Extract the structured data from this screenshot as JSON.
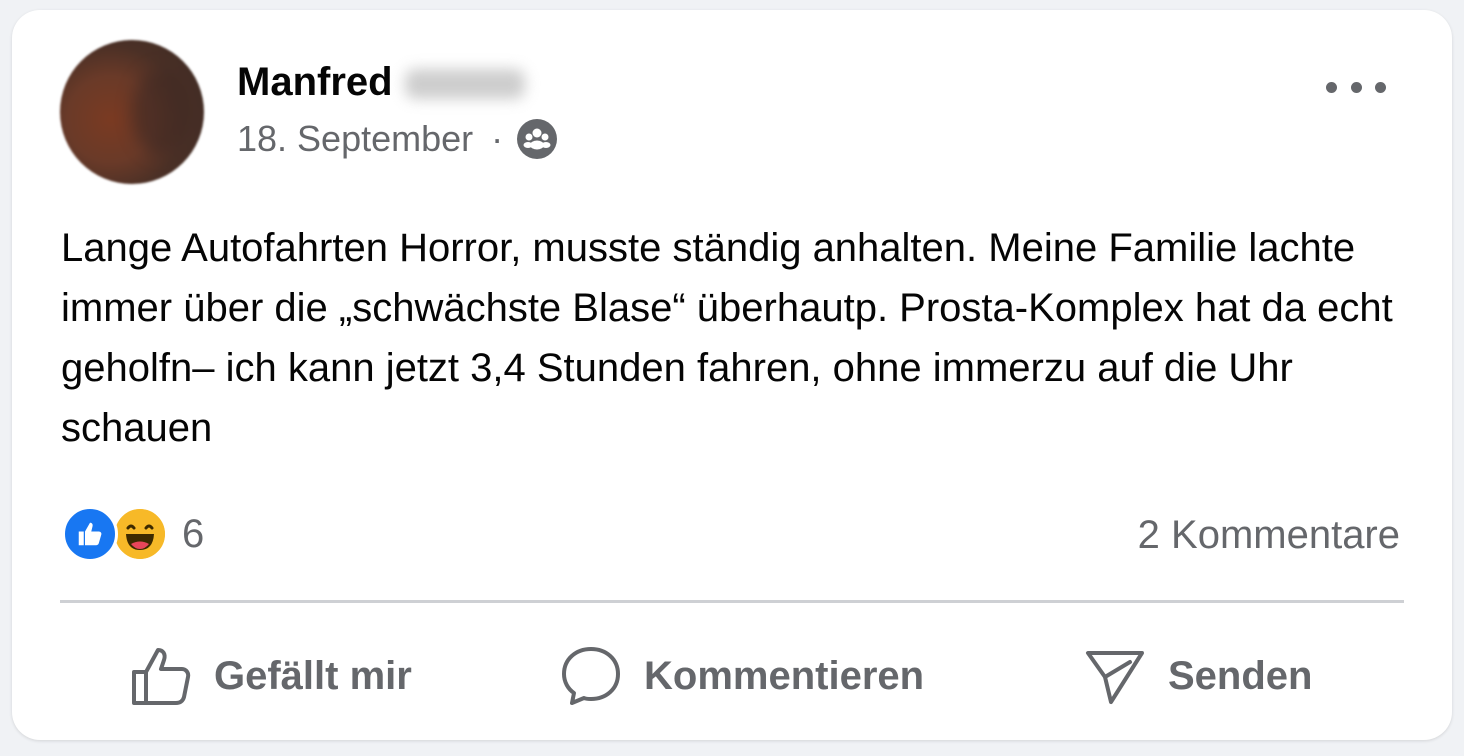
{
  "post": {
    "author_first": "Manfred",
    "date": "18. September",
    "separator": "·",
    "audience_icon": "group-icon",
    "text": "Lange Autofahrten Horror, musste ständig anhalten. Meine Familie lachte immer über die „schwächste Blase“ überhautp. Prosta-Komplex hat da echt geholfn– ich kann jetzt 3,4 Stunden fahren, ohne immerzu auf die Uhr schauen"
  },
  "reactions": {
    "icons": [
      "like-icon",
      "haha-icon"
    ],
    "count": "6"
  },
  "comments": {
    "label": "2 Kommentare"
  },
  "actions": {
    "like_label": "Gefällt mir",
    "comment_label": "Kommentieren",
    "send_label": "Senden"
  },
  "colors": {
    "like_blue": "#1877f2",
    "haha_yellow": "#f7b928",
    "secondary_text": "#65676b"
  }
}
